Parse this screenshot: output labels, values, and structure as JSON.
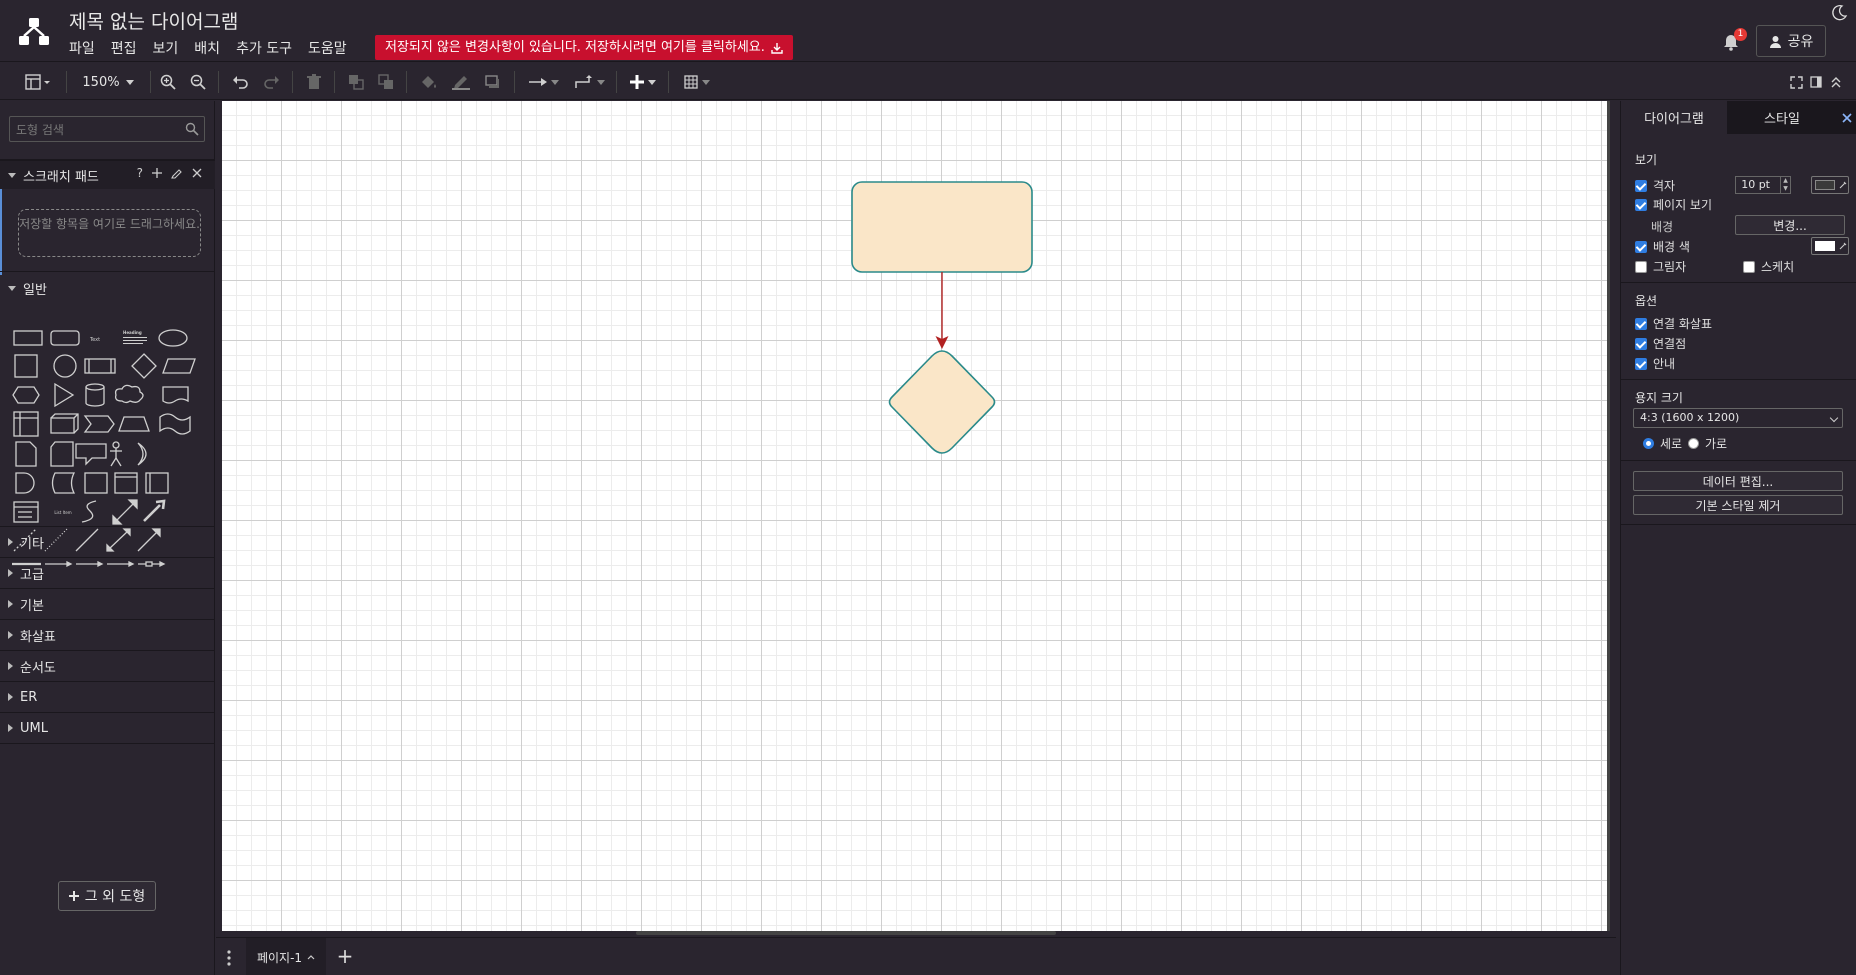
{
  "header": {
    "title": "제목 없는 다이어그램",
    "menus": [
      "파일",
      "편집",
      "보기",
      "배치",
      "추가 도구",
      "도움말"
    ],
    "unsaved_notice": "저장되지 않은 변경사항이 있습니다. 저장하시려면 여기를 클릭하세요.",
    "notification_count": "1",
    "share_label": "공유"
  },
  "toolbar": {
    "zoom": "150%"
  },
  "sidebar": {
    "search_placeholder": "도형 검색",
    "scratchpad_title": "스크래치 패드",
    "scratchpad_help": "?",
    "scratchpad_drop_text": "저장할 항목을 여기로 드래그하세요.",
    "general_title": "일반",
    "categories": [
      "기타",
      "고급",
      "기본",
      "화살표",
      "순서도",
      "ER",
      "UML"
    ],
    "more_shapes_label": "그 외 도형",
    "shape_text_label": "Text",
    "shape_heading_label": "Heading",
    "shape_listitem_label": "List Item"
  },
  "pages": {
    "current": "페이지-1"
  },
  "right_panel": {
    "tab_diagram": "다이어그램",
    "tab_style": "스타일",
    "view": {
      "title": "보기",
      "grid_label": "격자",
      "grid_size": "10 pt",
      "grid_color": "#3a3a3a",
      "page_view_label": "페이지 보기",
      "background_label": "배경",
      "change_button": "변경...",
      "background_color_label": "배경 색",
      "background_color": "#ffffff",
      "shadow_label": "그림자",
      "sketch_label": "스케치"
    },
    "options": {
      "title": "옵션",
      "connection_arrows": "연결 화살표",
      "connection_points": "연결점",
      "guides": "안내"
    },
    "paper": {
      "title": "용지 크기",
      "selected": "4:3 (1600 x 1200)",
      "portrait": "세로",
      "landscape": "가로"
    },
    "edit_data_button": "데이터 편집...",
    "clear_style_button": "기본 스타일 제거"
  },
  "diagram": {
    "shape_fill": "#fae6c8",
    "shape_stroke": "#2a8a8a",
    "edge_color": "#b22222"
  }
}
